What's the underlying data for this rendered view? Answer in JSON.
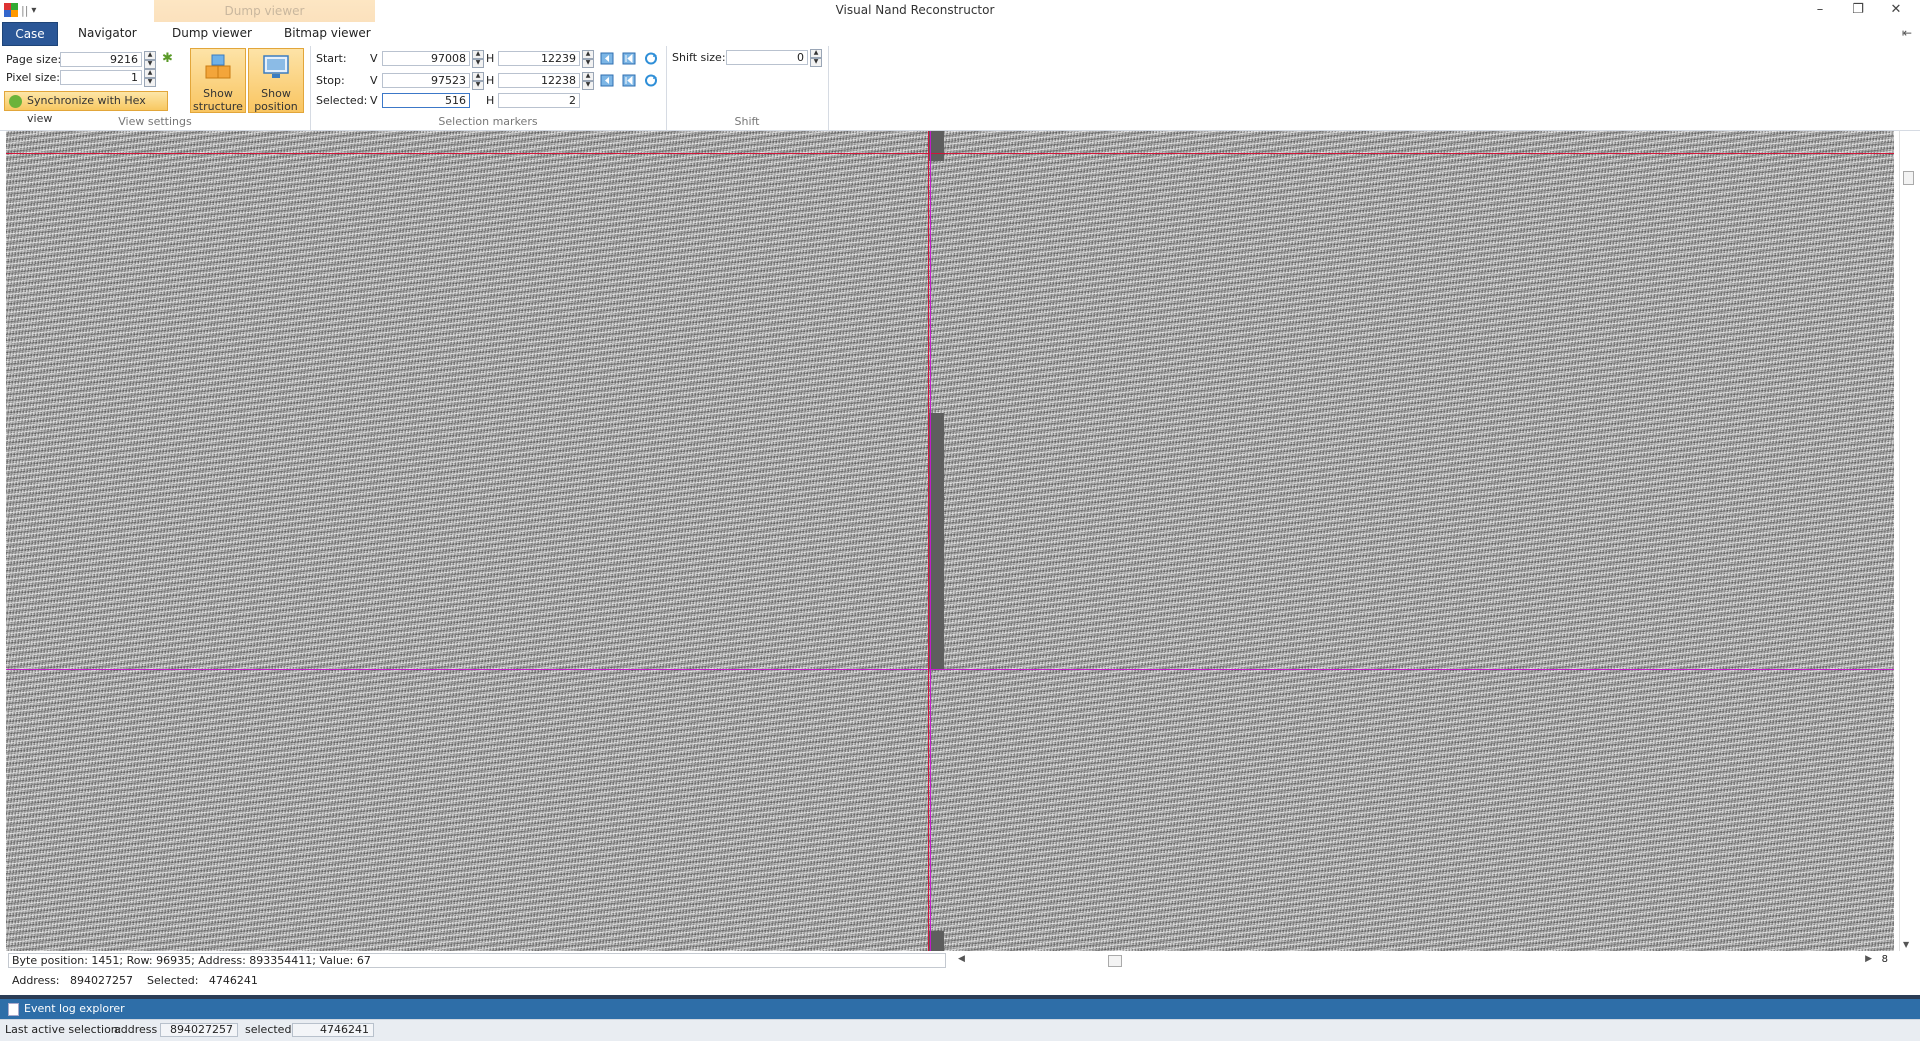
{
  "window": {
    "title": "Visual Nand Reconstructor",
    "context_tab": "Dump viewer",
    "minimize": "–",
    "restore": "❐",
    "close": "✕",
    "qat_sep": "||",
    "qat_arrow": "▾",
    "pin": "⇤"
  },
  "tabs": [
    "Case",
    "Navigator",
    "Dump viewer",
    "Bitmap viewer"
  ],
  "view_settings": {
    "label": "View settings",
    "page_size_label": "Page size:",
    "page_size": "9216",
    "pixel_size_label": "Pixel size:",
    "pixel_size": "1",
    "show_structure": [
      "Show",
      "structure"
    ],
    "show_position": [
      "Show",
      "position"
    ],
    "sync_button": "Synchronize with Hex view"
  },
  "selection_markers": {
    "label": "Selection markers",
    "start_label": "Start:",
    "stop_label": "Stop:",
    "selected_label": "Selected:",
    "v": "V",
    "h": "H",
    "start_v": "97008",
    "start_h": "12239",
    "stop_v": "97523",
    "stop_h": "12238",
    "selected_v": "516",
    "selected_h": "2"
  },
  "shift": {
    "label": "Shift",
    "shift_size_label": "Shift size:",
    "shift_size": "0"
  },
  "viewer": {
    "info": "Byte position: 1451; Row: 96935; Address: 893354411; Value: 67",
    "scroll_value": "8",
    "address_label": "Address:",
    "address": "894027257",
    "selected_label": "Selected:",
    "selected": "4746241"
  },
  "bottom_pane": {
    "tab": "Event log explorer"
  },
  "status": {
    "prefix": "Last active selection:",
    "address_label": "address",
    "address": "894027257",
    "selected_label": "selected",
    "selected": "4746241"
  },
  "colors": {
    "accent": "#2b5797",
    "marker_red": "#d0163a",
    "marker_magenta": "#c01ec8"
  }
}
